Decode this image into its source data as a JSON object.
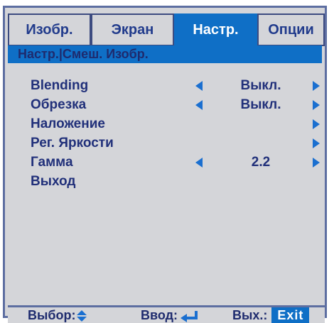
{
  "tabs": [
    {
      "label": "Изобр.",
      "active": false
    },
    {
      "label": "Экран",
      "active": false
    },
    {
      "label": "Настр.",
      "active": true
    },
    {
      "label": "Опции",
      "active": false
    }
  ],
  "breadcrumb": "Настр.|Смеш. Изобр.",
  "menu": {
    "items": [
      {
        "label": "Blending",
        "value": "Выкл.",
        "left_arrow": true,
        "right_arrow": true
      },
      {
        "label": "Обрезка",
        "value": "Выкл.",
        "left_arrow": true,
        "right_arrow": true
      },
      {
        "label": "Наложение",
        "value": "",
        "left_arrow": false,
        "right_arrow": true
      },
      {
        "label": "Рег. Яркости",
        "value": "",
        "left_arrow": false,
        "right_arrow": true
      },
      {
        "label": "Гамма",
        "value": "2.2",
        "left_arrow": true,
        "right_arrow": true
      },
      {
        "label": "Выход",
        "value": "",
        "left_arrow": false,
        "right_arrow": false
      }
    ]
  },
  "footer": {
    "select_label": "Выбор:",
    "enter_label": "Ввод:",
    "exit_label": "Вых.:",
    "exit_key": "Exit"
  },
  "colors": {
    "accent": "#0f6fc6",
    "panel_bg": "#d4d5d9",
    "text": "#21307a",
    "border": "#5d6ea1"
  },
  "icons": [
    "left-arrow-icon",
    "right-arrow-icon",
    "up-down-arrows-icon",
    "enter-icon"
  ]
}
